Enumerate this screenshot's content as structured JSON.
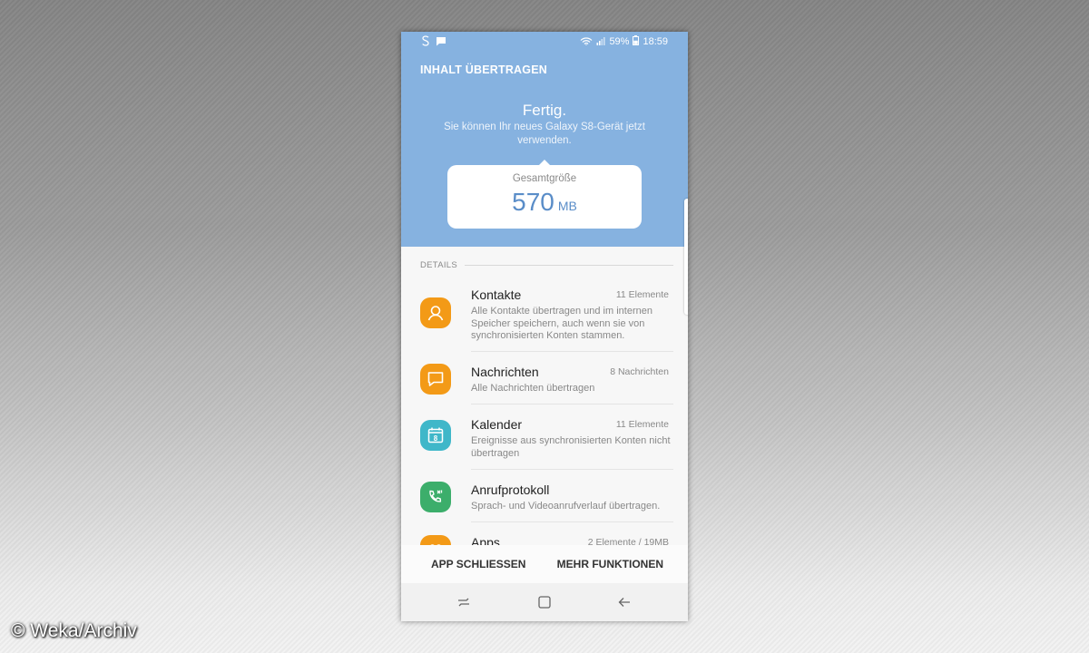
{
  "status_bar": {
    "left_icons": [
      "samsung-s-icon",
      "message-icon"
    ],
    "battery": "59%",
    "time": "18:59"
  },
  "header": {
    "title": "INHALT ÜBERTRAGEN"
  },
  "result": {
    "title": "Fertig.",
    "subtitle": "Sie können Ihr neues Galaxy S8-Gerät jetzt verwenden.",
    "size_label": "Gesamtgröße",
    "size_value": "570",
    "size_unit": "MB"
  },
  "details": {
    "header": "DETAILS",
    "items": [
      {
        "name": "Kontakte",
        "count": "11 Elemente",
        "description": "Alle Kontakte übertragen und im internen Speicher speichern, auch wenn sie von synchronisierten Konten stammen.",
        "icon": "contact-icon",
        "color": "#f39a17"
      },
      {
        "name": "Nachrichten",
        "count": "8 Nachrichten",
        "description": "Alle Nachrichten übertragen",
        "icon": "message-bubble-icon",
        "color": "#f39a17"
      },
      {
        "name": "Kalender",
        "count": "11 Elemente",
        "description": "Ereignisse aus synchronisierten Konten nicht übertragen",
        "icon": "calendar-icon",
        "calendar_day": "8",
        "color": "#3fb7c9"
      },
      {
        "name": "Anrufprotokoll",
        "count": "",
        "description": "Sprach- und Videoanrufverlauf übertragen.",
        "icon": "call-log-icon",
        "color": "#3cae6b"
      },
      {
        "name": "Apps",
        "count": "2 Elemente / 19MB",
        "description": "",
        "icon": "apps-icon",
        "color": "#f39a17"
      }
    ]
  },
  "actions": {
    "close_label": "APP SCHLIESSEN",
    "more_label": "MEHR FUNKTIONEN"
  },
  "nav": {
    "icons": [
      "recent-apps-icon",
      "home-icon",
      "back-icon"
    ]
  },
  "watermark": "© Weka/Archiv"
}
